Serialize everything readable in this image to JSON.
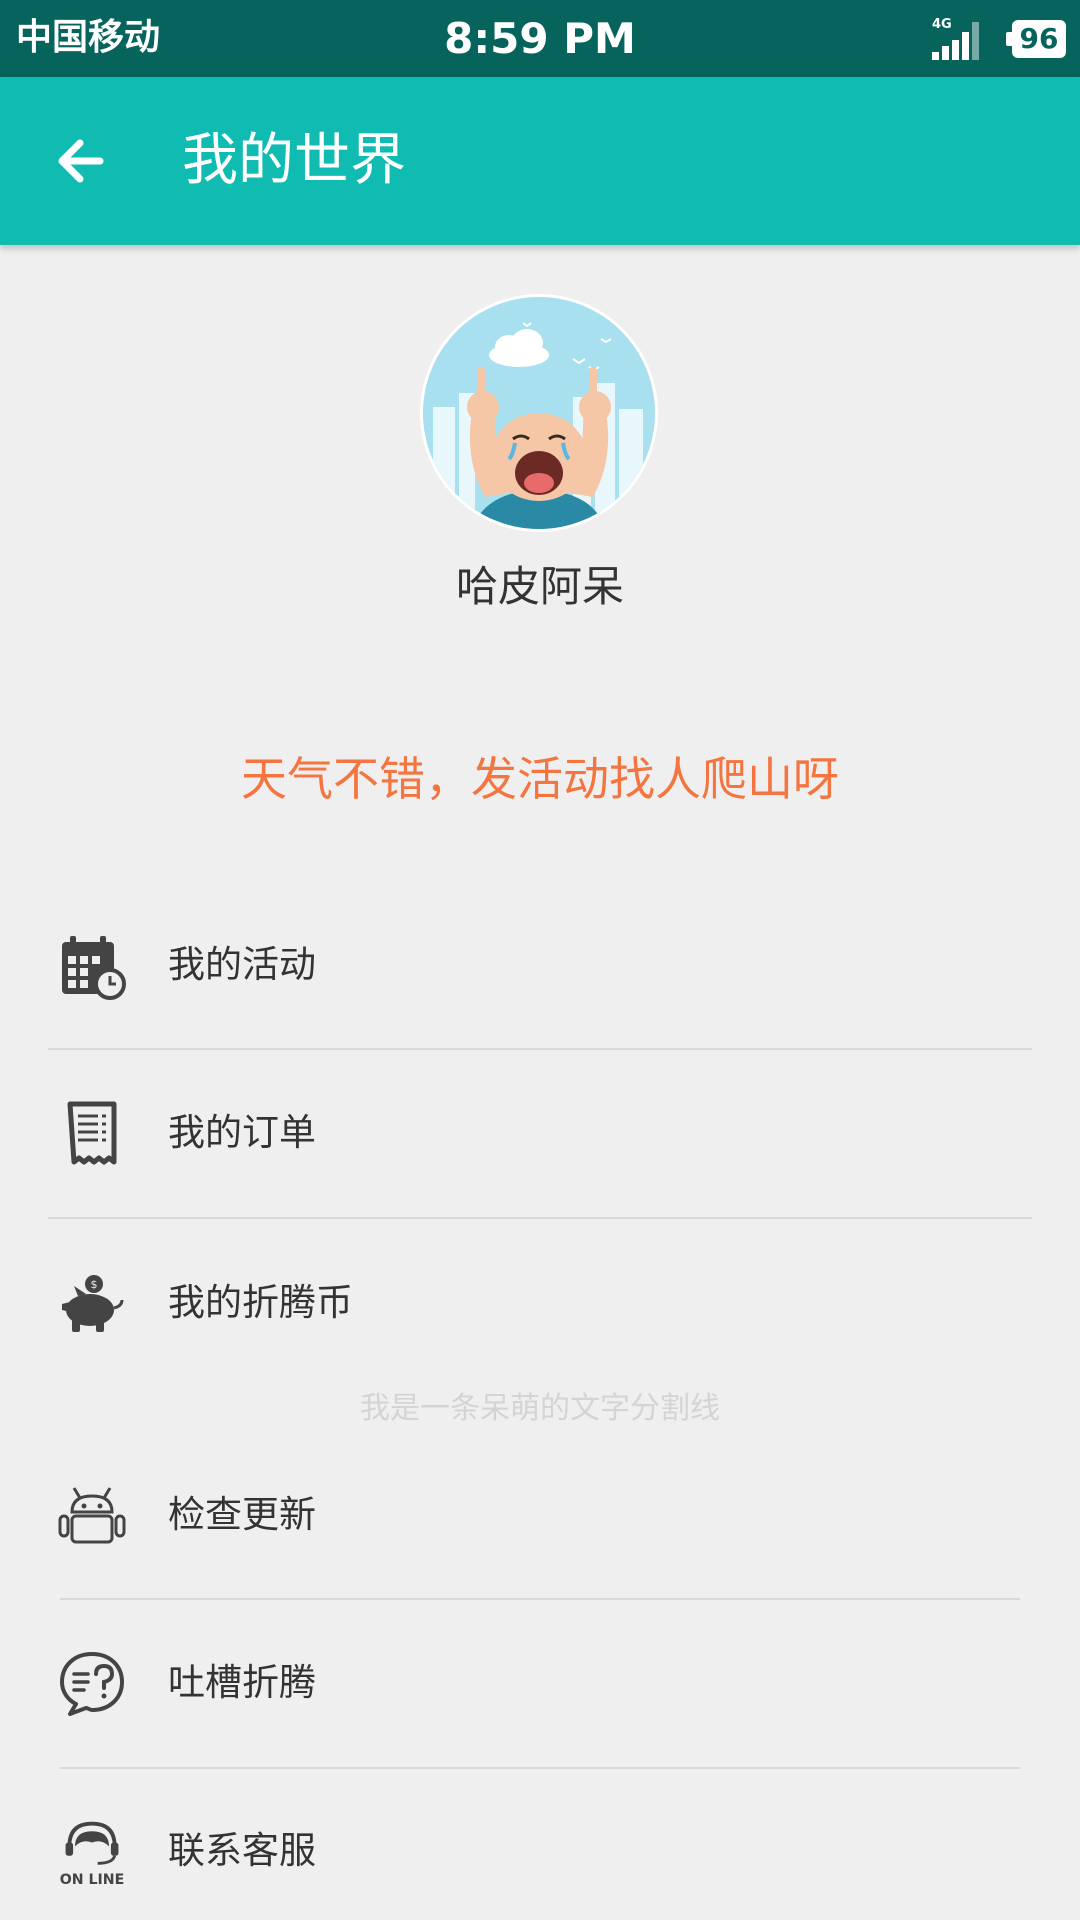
{
  "status_bar": {
    "carrier": "中国移动",
    "time": "8:59 PM",
    "network": "4G",
    "battery": "96"
  },
  "app_bar": {
    "title": "我的世界"
  },
  "profile": {
    "username": "哈皮阿呆"
  },
  "banner": {
    "slogan": "天气不错，发活动找人爬山呀"
  },
  "menu": {
    "group1": [
      {
        "label": "我的活动",
        "icon": "calendar-clock-icon"
      },
      {
        "label": "我的订单",
        "icon": "receipt-icon"
      },
      {
        "label": "我的折腾币",
        "icon": "piggy-bank-icon"
      }
    ],
    "splitter_text": "我是一条呆萌的文字分割线",
    "group2": [
      {
        "label": "检查更新",
        "icon": "android-icon"
      },
      {
        "label": "吐槽折腾",
        "icon": "feedback-chat-icon"
      },
      {
        "label": "联系客服",
        "icon": "online-support-icon"
      }
    ],
    "support_icon_text": "ON LINE"
  },
  "colors": {
    "status_bar": "#07645d",
    "app_bar": "#10bbb2",
    "accent_orange": "#f4753f",
    "background": "#efefef"
  }
}
